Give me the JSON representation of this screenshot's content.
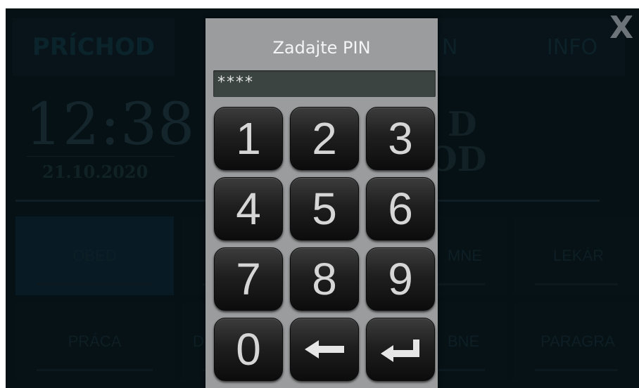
{
  "background": {
    "tabs": [
      "PRÍCHOD",
      "N",
      "INFO"
    ],
    "clock": {
      "time": "12:38",
      "date": "21.10.2020"
    },
    "status_text": [
      "D",
      "OD"
    ],
    "buttons_row1": [
      "OBED",
      "MNE",
      "LEKÁR"
    ],
    "buttons_row2": [
      "PRÁCA",
      "D",
      "BNE",
      "PARAGRA"
    ],
    "close_label": "X"
  },
  "pin_dialog": {
    "title": "Zadajte PIN",
    "value": "****",
    "keys": [
      "1",
      "2",
      "3",
      "4",
      "5",
      "6",
      "7",
      "8",
      "9",
      "0"
    ],
    "backspace_icon": "arrow-left-icon",
    "enter_icon": "enter-return-icon"
  },
  "colors": {
    "screen_bg": "#0b1f27",
    "dialog_bg": "#9a9c9d",
    "key_bg": "#1f1f1f",
    "key_text": "#d6d6d6"
  }
}
